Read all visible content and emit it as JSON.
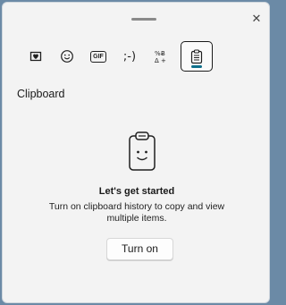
{
  "panel": {
    "close_glyph": "✕"
  },
  "tabs": [
    {
      "name": "kaomoji-heart-icon",
      "label": ""
    },
    {
      "name": "emoji-icon",
      "label": ""
    },
    {
      "name": "gif-icon",
      "label": "GIF"
    },
    {
      "name": "kaomoji-icon",
      "label": ";-)"
    },
    {
      "name": "symbols-icon",
      "label": "%Ƀ\nΔ+"
    },
    {
      "name": "clipboard-icon",
      "label": "",
      "active": true
    }
  ],
  "section": {
    "title": "Clipboard"
  },
  "empty_state": {
    "heading": "Let's get started",
    "description": "Turn on clipboard history to copy and view multiple items.",
    "button_label": "Turn on"
  },
  "colors": {
    "accent": "#0e6f8a",
    "background": "#f3f3f3",
    "outer": "#6b8aa6"
  }
}
